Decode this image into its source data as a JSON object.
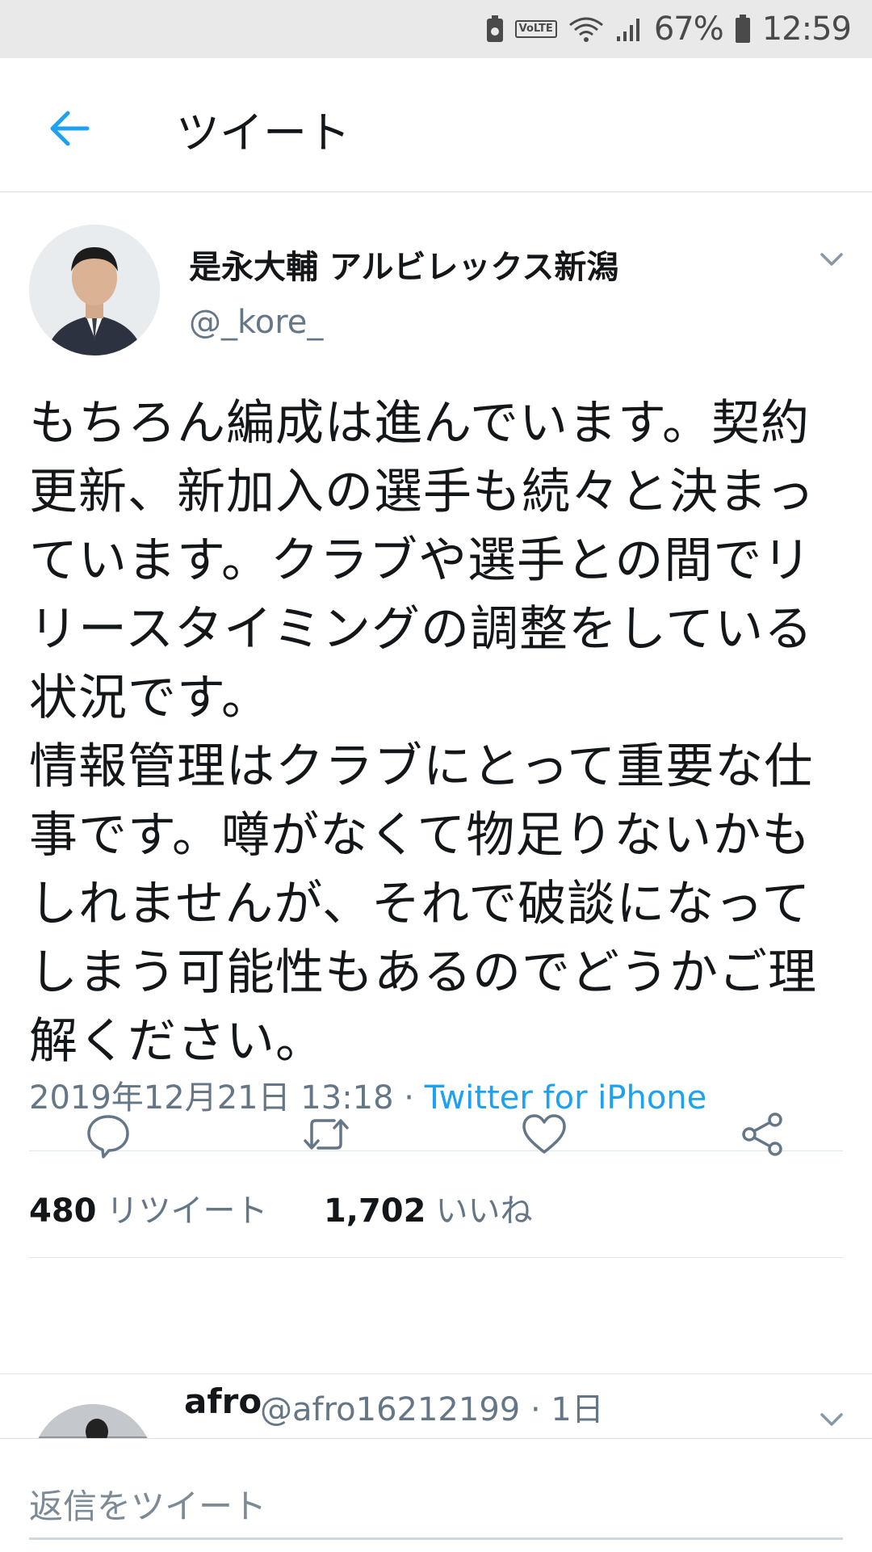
{
  "status_bar": {
    "battery": "67%",
    "time": "12:59",
    "volte": "VoLTE"
  },
  "header": {
    "title": "ツイート"
  },
  "tweet": {
    "author_name": "是永大輔 アルビレックス新潟",
    "author_handle": "@_kore_",
    "body": "もちろん編成は進んでいます。契約\n更新、新加入の選手も続々と決まっ\nています。クラブや選手との間でリ\nリースタイミングの調整をしている\n状況です。\n情報管理はクラブにとって重要な仕\n事です。噂がなくて物足りないかも\nしれませんが、それで破談になって\nしまう可能性もあるのでどうかご理\n解ください。",
    "timestamp": "2019年12月21日 13:18",
    "separator": " · ",
    "source": "Twitter for iPhone",
    "retweets_count": "480",
    "retweets_label": "リツイート",
    "likes_count": "1,702",
    "likes_label": "いいね"
  },
  "reply_preview": {
    "name": "afro",
    "handle_time": "@afro16212199 · 1日"
  },
  "compose": {
    "placeholder": "返信をツイート"
  },
  "colors": {
    "accent": "#1da1f2",
    "secondary_text": "#657786",
    "status_bar_bg": "#e9e9e9"
  },
  "icons": [
    "back-arrow-icon",
    "chevron-down-icon",
    "reply-icon",
    "retweet-icon",
    "like-icon",
    "share-icon"
  ]
}
